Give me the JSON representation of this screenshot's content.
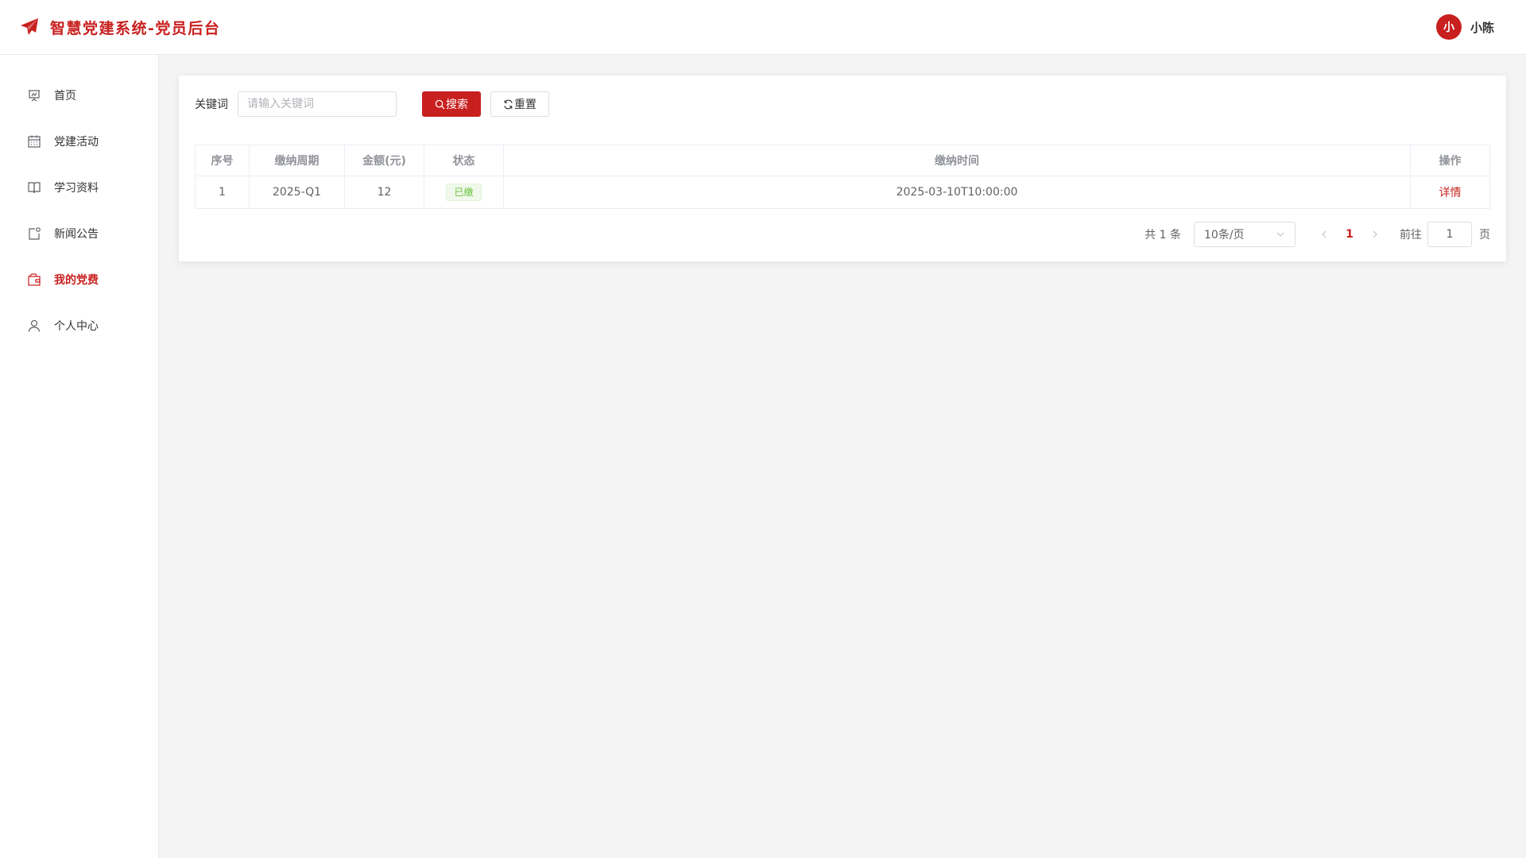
{
  "header": {
    "title": "智慧党建系统-党员后台",
    "user": {
      "avatar_text": "小",
      "name": "小陈"
    }
  },
  "sidebar": {
    "items": [
      {
        "label": "首页",
        "icon": "presentation-icon",
        "active": false
      },
      {
        "label": "党建活动",
        "icon": "calendar-icon",
        "active": false
      },
      {
        "label": "学习资料",
        "icon": "book-icon",
        "active": false
      },
      {
        "label": "新闻公告",
        "icon": "notification-icon",
        "active": false
      },
      {
        "label": "我的党费",
        "icon": "wallet-icon",
        "active": true
      },
      {
        "label": "个人中心",
        "icon": "user-icon",
        "active": false
      }
    ]
  },
  "search": {
    "label": "关键词",
    "placeholder": "请输入关键词",
    "value": "",
    "search_button": "搜索",
    "reset_button": "重置"
  },
  "table": {
    "columns": [
      "序号",
      "缴纳周期",
      "金额(元)",
      "状态",
      "缴纳时间",
      "操作"
    ],
    "rows": [
      {
        "index": "1",
        "period": "2025-Q1",
        "amount": "12",
        "status": "已缴",
        "paid_time": "2025-03-10T10:00:00",
        "action": "详情"
      }
    ]
  },
  "pagination": {
    "total_text": "共 1 条",
    "page_size": "10条/页",
    "current_page": "1",
    "goto_label": "前往",
    "goto_value": "1",
    "page_suffix": "页"
  },
  "colors": {
    "brand": "#c8201f",
    "success": "#67c23a",
    "background": "#f4f4f4"
  }
}
